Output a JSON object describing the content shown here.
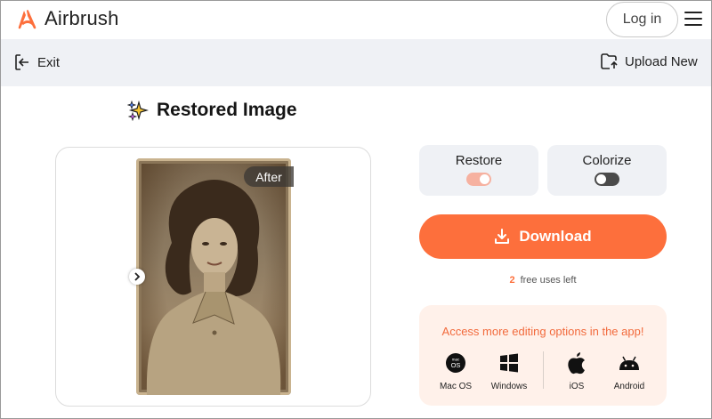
{
  "header": {
    "brand": "Airbrush",
    "login_label": "Log in"
  },
  "toolbar": {
    "exit_label": "Exit",
    "upload_label": "Upload New"
  },
  "main": {
    "title": "Restored Image",
    "after_label": "After"
  },
  "options": [
    {
      "label": "Restore",
      "enabled": true
    },
    {
      "label": "Colorize",
      "enabled": false
    }
  ],
  "download": {
    "label": "Download",
    "free_uses_count": "2",
    "free_uses_text": "free uses left"
  },
  "promo": {
    "title": "Access more editing options in the app!",
    "platforms": [
      {
        "label": "Mac OS",
        "icon": "macos-icon"
      },
      {
        "label": "Windows",
        "icon": "windows-icon"
      },
      {
        "label": "iOS",
        "icon": "apple-icon"
      },
      {
        "label": "Android",
        "icon": "android-icon"
      }
    ]
  },
  "colors": {
    "accent": "#fd6f3c",
    "toolbar_bg": "#eff1f5",
    "promo_bg": "#fff1ea",
    "toggle_on": "#f6b1a0",
    "toggle_off": "#4a4a4a"
  }
}
